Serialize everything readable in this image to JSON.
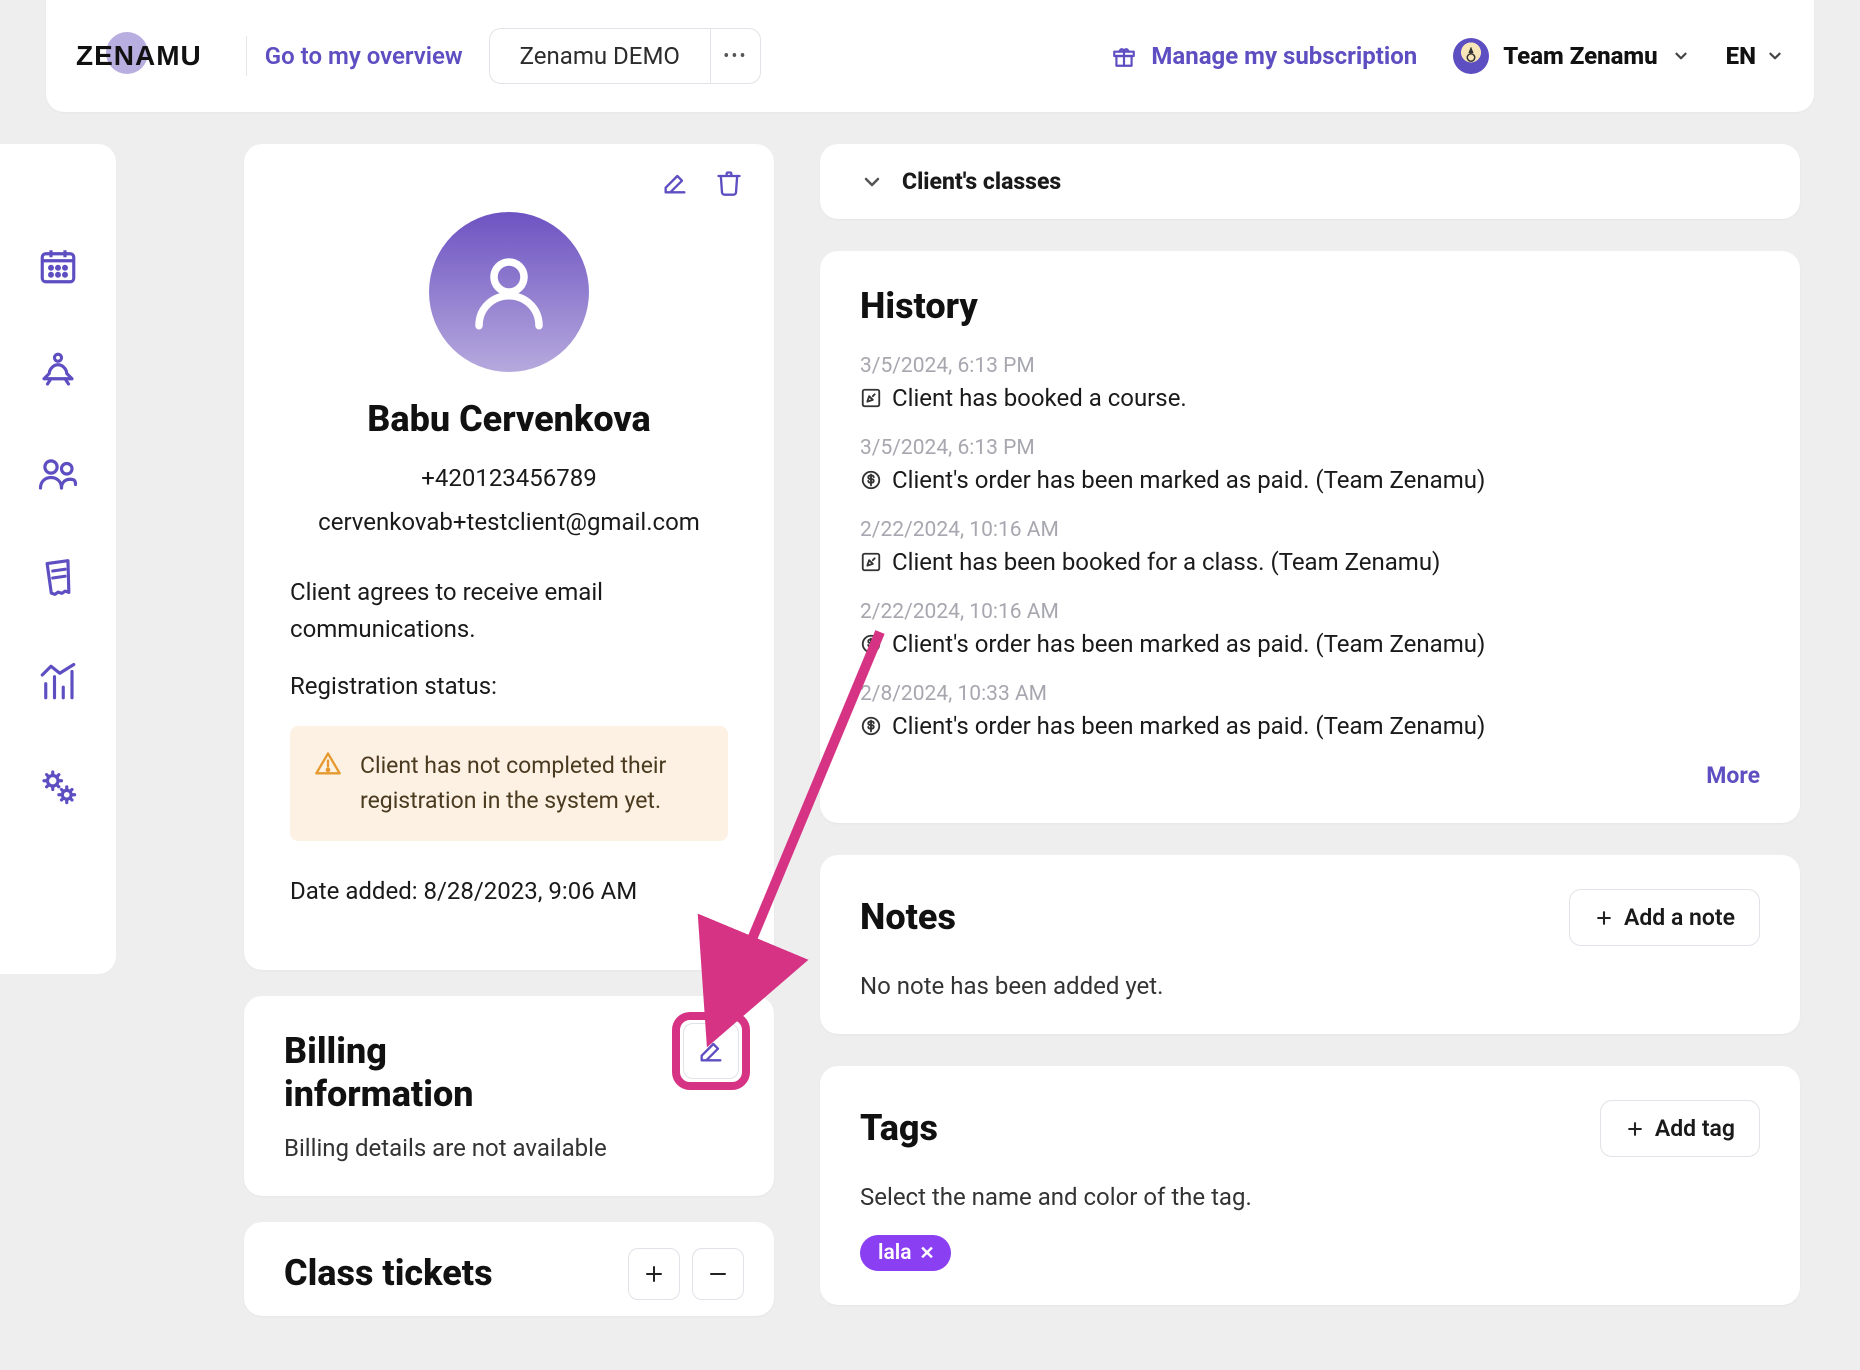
{
  "header": {
    "logo_text": "ZENAMU",
    "overview_link": "Go to my overview",
    "demo_label": "Zenamu DEMO",
    "more_dots": "•••",
    "subscription_link": "Manage my subscription",
    "team_label": "Team Zenamu",
    "lang_label": "EN"
  },
  "profile": {
    "name": "Babu Cervenkova",
    "phone": "+420123456789",
    "email": "cervenkovab+testclient@gmail.com",
    "comm_text": "Client agrees to receive email communications.",
    "reg_status_label": "Registration status:",
    "reg_warning": "Client has not completed their registration in the system yet.",
    "date_added_label": "Date added: ",
    "date_added_value": "8/28/2023, 9:06 AM"
  },
  "billing": {
    "title": "Billing information",
    "empty_text": "Billing details are not available"
  },
  "tickets": {
    "title": "Class tickets"
  },
  "classes_collapse": {
    "label": "Client's classes"
  },
  "history": {
    "title": "History",
    "items": [
      {
        "time": "3/5/2024, 6:13 PM",
        "icon": "edit",
        "text": "Client has booked a course."
      },
      {
        "time": "3/5/2024, 6:13 PM",
        "icon": "dollar",
        "text": "Client's order has been marked as paid. (Team Zenamu)"
      },
      {
        "time": "2/22/2024, 10:16 AM",
        "icon": "edit",
        "text": "Client has been booked for a class. (Team Zenamu)"
      },
      {
        "time": "2/22/2024, 10:16 AM",
        "icon": "dollar",
        "text": "Client's order has been marked as paid. (Team Zenamu)"
      },
      {
        "time": "2/8/2024, 10:33 AM",
        "icon": "dollar",
        "text": "Client's order has been marked as paid. (Team Zenamu)"
      }
    ],
    "more_label": "More"
  },
  "notes": {
    "title": "Notes",
    "add_label": "Add a note",
    "empty_text": "No note has been added yet."
  },
  "tags": {
    "title": "Tags",
    "add_label": "Add tag",
    "hint": "Select the name and color of the tag.",
    "items": [
      {
        "label": "lala",
        "color": "#8b3ff2"
      }
    ]
  }
}
